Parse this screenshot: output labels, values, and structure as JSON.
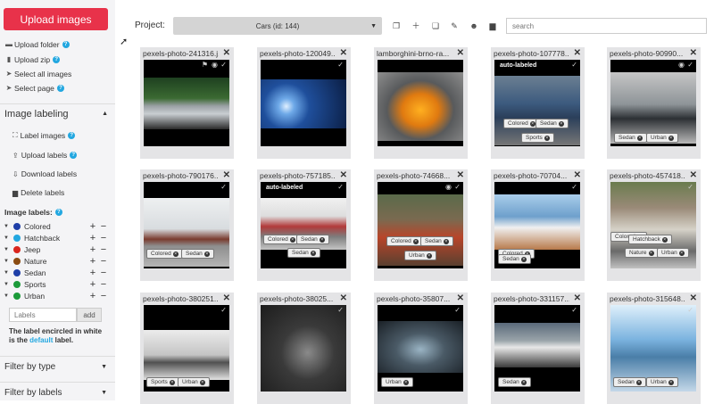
{
  "sidebar": {
    "upload_images": "Upload images",
    "actions": [
      "Upload folder",
      "Upload zip",
      "Select all images",
      "Select page"
    ],
    "image_labeling": {
      "title": "Image labeling",
      "items": [
        "Label images",
        "Upload labels",
        "Download labels",
        "Delete labels"
      ]
    },
    "image_labels_title": "Image labels:",
    "labels": [
      {
        "name": "Colored",
        "color": "#1f3fa8"
      },
      {
        "name": "Hatchback",
        "color": "#22a7e0"
      },
      {
        "name": "Jeep",
        "color": "#d9251d"
      },
      {
        "name": "Nature",
        "color": "#8a4b12"
      },
      {
        "name": "Sedan",
        "color": "#1f3fa8"
      },
      {
        "name": "Sports",
        "color": "#1c9a3a"
      },
      {
        "name": "Urban",
        "color": "#1c9a3a"
      }
    ],
    "labels_placeholder": "Labels",
    "add_label": "add",
    "note_part1": "The label encircled in white is the",
    "note_default": "default",
    "note_part2": "label.",
    "filter_by_type": "Filter by type",
    "filter_by_labels": "Filter by labels"
  },
  "topbar": {
    "project_label": "Project:",
    "project_value": "Cars (id: 144)",
    "search_placeholder": "search"
  },
  "grid": [
    {
      "title": "pexels-photo-241316.j...",
      "icons": [
        "flag",
        "eye",
        "check"
      ],
      "auto": "",
      "tags": []
    },
    {
      "title": "pexels-photo-120049...",
      "icons": [
        "check"
      ],
      "auto": "",
      "tags": []
    },
    {
      "title": "lamborghini-brno-ra...",
      "icons": [],
      "auto": "",
      "tags": []
    },
    {
      "title": "pexels-photo-107778...",
      "icons": [
        "check"
      ],
      "auto": "auto-labeled",
      "tags": [
        "Colored",
        "Sedan",
        "Sports"
      ]
    },
    {
      "title": "pexels-photo-90990...",
      "icons": [
        "eye",
        "check"
      ],
      "auto": "",
      "tags": [
        "Sedan",
        "Urban"
      ]
    },
    {
      "title": "pexels-photo-790176...",
      "icons": [
        "check"
      ],
      "auto": "",
      "tags": [
        "Colored",
        "Sedan"
      ]
    },
    {
      "title": "pexels-photo-757185...",
      "icons": [
        "check"
      ],
      "auto": "auto-labeled",
      "tags": [
        "Colored",
        "Sedan",
        "Sedan"
      ]
    },
    {
      "title": "pexels-photo-74668...",
      "icons": [
        "eye",
        "check"
      ],
      "auto": "",
      "tags": [
        "Colored",
        "Sedan",
        "Urban"
      ]
    },
    {
      "title": "pexels-photo-70704...",
      "icons": [
        "check"
      ],
      "auto": "",
      "tags": [
        "Colored",
        "Sedan"
      ]
    },
    {
      "title": "pexels-photo-457418...",
      "icons": [
        "check"
      ],
      "auto": "",
      "tags": [
        "Colored",
        "Hatchback",
        "Nature",
        "Urban"
      ]
    },
    {
      "title": "pexels-photo-380251...",
      "icons": [
        "check"
      ],
      "auto": "",
      "tags": [
        "Sports",
        "Urban"
      ]
    },
    {
      "title": "pexels-photo-38025...",
      "icons": [
        "check"
      ],
      "auto": "",
      "tags": []
    },
    {
      "title": "pexels-photo-35807...",
      "icons": [
        "check"
      ],
      "auto": "",
      "tags": [
        "Urban"
      ]
    },
    {
      "title": "pexels-photo-331157...",
      "icons": [
        "check"
      ],
      "auto": "",
      "tags": [
        "Sedan"
      ]
    },
    {
      "title": "pexels-photo-315648...",
      "icons": [
        "check"
      ],
      "auto": "",
      "tags": [
        "Sedan",
        "Urban"
      ]
    }
  ]
}
